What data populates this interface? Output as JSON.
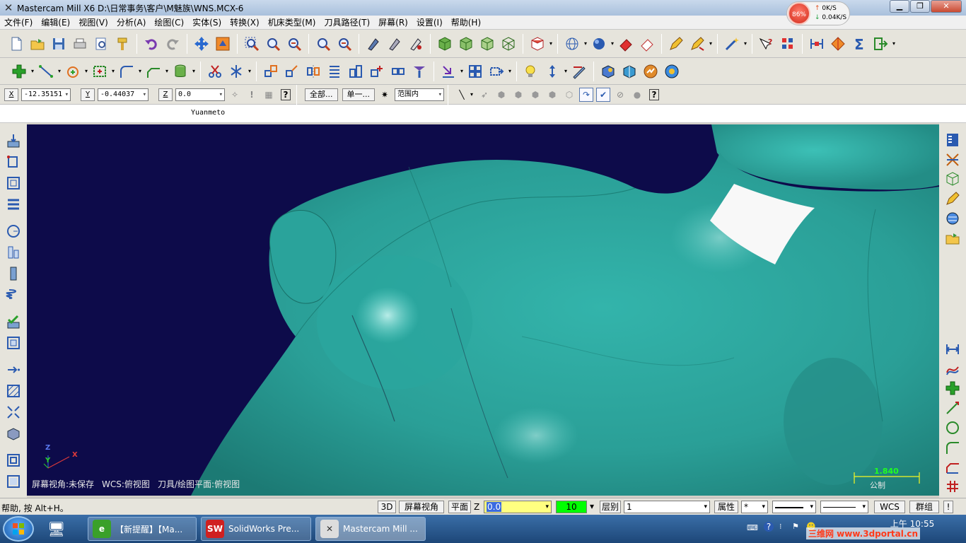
{
  "window": {
    "title": "Mastercam Mill X6  D:\\日常事务\\客户\\M魅族\\WNS.MCX-6",
    "min_icon": "minimize-icon",
    "max_icon": "maximize-icon",
    "close_icon": "close-icon"
  },
  "net_widget": {
    "percent": "86%",
    "up_rate": "0K/S",
    "down_rate": "0.04K/S"
  },
  "menu": [
    "文件(F)",
    "编辑(E)",
    "视图(V)",
    "分析(A)",
    "绘图(C)",
    "实体(S)",
    "转换(X)",
    "机床类型(M)",
    "刀具路径(T)",
    "屏幕(R)",
    "设置(I)",
    "帮助(H)"
  ],
  "coords": {
    "x_label": "X",
    "x_value": "-12.35151",
    "y_label": "Y",
    "y_value": "-0.44037",
    "z_label": "Z",
    "z_value": "0.0",
    "select_all": "全部...",
    "select_single": "单一...",
    "range": "范围内"
  },
  "prompt": "Yuanmeto",
  "viewport": {
    "screen_view": "屏幕视角:未保存",
    "wcs": "WCS:俯视图",
    "tool_plane": "刀具/绘图平面:俯视图",
    "scale_value": "1.840",
    "scale_unit": "公制",
    "axis_z": "Z",
    "axis_y": "Y",
    "axis_x": "X"
  },
  "status": {
    "help": "帮助, 按 Alt+H。",
    "btn_3d": "3D",
    "btn_screen_view": "屏幕视角",
    "btn_plane": "平面",
    "z_label": "Z",
    "z_value": "0.0",
    "color_value": "10",
    "level_label": "层别",
    "level_value": "1",
    "attr": "属性",
    "point_style": "*",
    "wcs": "WCS",
    "group": "群组",
    "bang": "!"
  },
  "taskbar": {
    "tasks": [
      "【新提醒】【Ma...",
      "SolidWorks Pre...",
      "Mastercam Mill ..."
    ],
    "clock_period": "上午",
    "clock_time": "10:55",
    "watermark": "三维网 www.3dportal.cn"
  },
  "colors": {
    "viewport_bg": "#0d0b4a",
    "model": "#2aa39b",
    "scale_green": "#20ff20",
    "color_field": "#00ff00",
    "z_field": "#ffff80"
  }
}
